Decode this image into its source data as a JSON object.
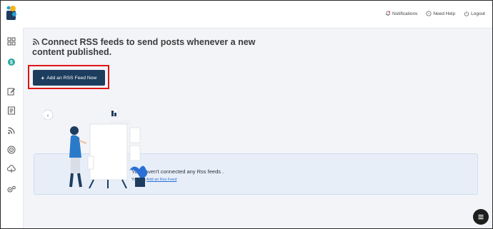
{
  "topbar": {
    "notifications_label": "Notifications",
    "help_label": "Need Help",
    "logout_label": "Logout"
  },
  "sidebar": {
    "icons": [
      "grid-icon",
      "dollar-coin-icon",
      "edit-icon",
      "document-icon",
      "rss-icon",
      "target-icon",
      "cloud-upload-icon",
      "settings-icon"
    ]
  },
  "main": {
    "heading": "Connect RSS feeds to send posts whenever a new content published.",
    "add_button_label": "Add an RSS Feed Now",
    "empty_title": "You haven't connected any Rss feeds .",
    "empty_sub_prefix": "You can",
    "empty_sub_link": "Add an Rss Feed"
  },
  "colors": {
    "primary_button": "#1d3d5e",
    "highlight_box": "#e01515",
    "link": "#2a6fd6",
    "empty_card_bg": "#e7eef8"
  }
}
